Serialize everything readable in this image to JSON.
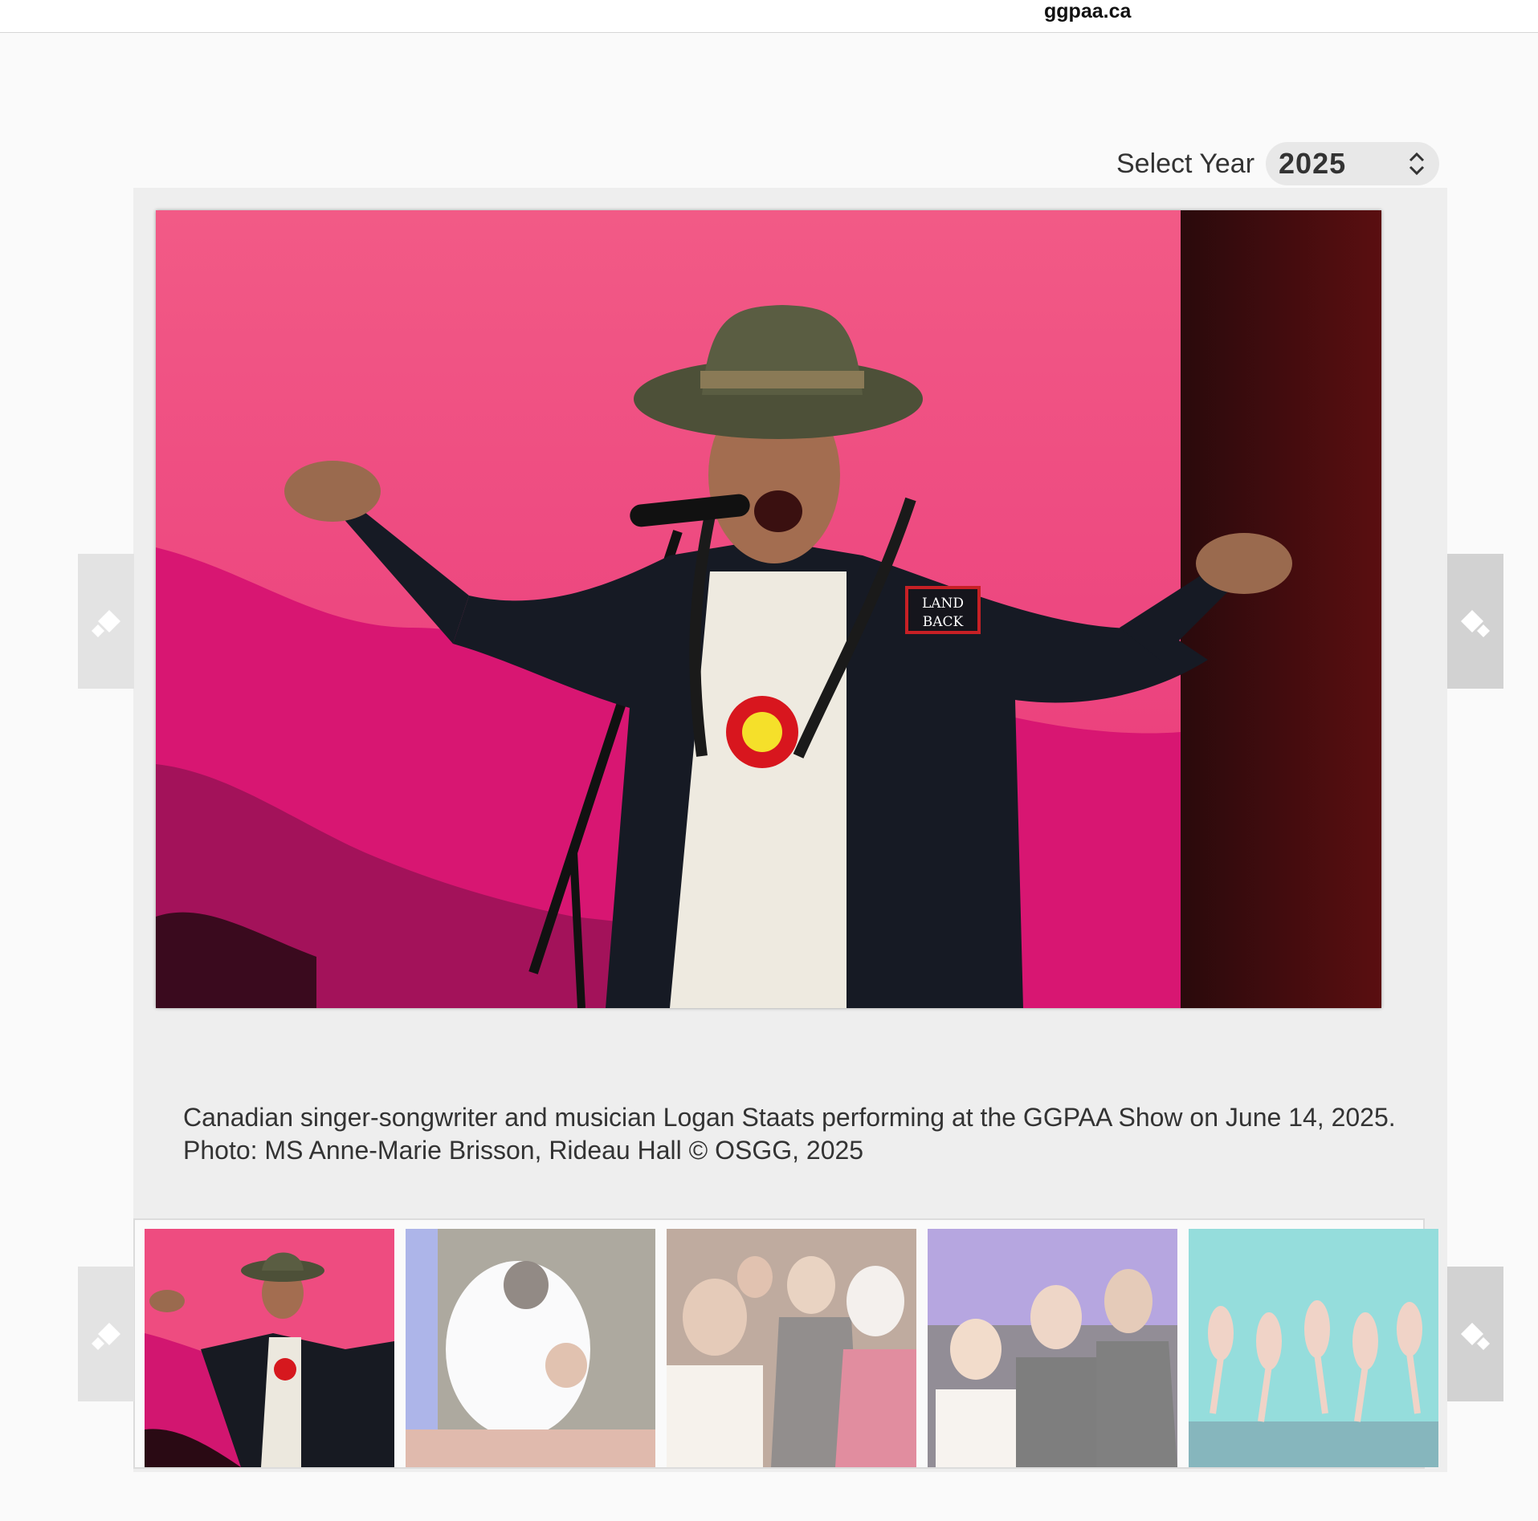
{
  "browser": {
    "url": "ggpaa.ca"
  },
  "year_selector": {
    "label": "Select Year",
    "value": "2025"
  },
  "gallery": {
    "caption": "Canadian singer-songwriter and musician Logan Staats performing at the GGPAA Show on June 14, 2025. Photo: MS Anne-Marie Brisson, Rideau Hall © OSGG, 2025",
    "main_image": {
      "patch_text_1": "LAND",
      "patch_text_2": "BACK"
    },
    "thumbnails": [
      {
        "id": "performer-singing",
        "active": true
      },
      {
        "id": "white-feathers-embrace",
        "active": false
      },
      {
        "id": "reception-group",
        "active": false
      },
      {
        "id": "three-guests-portrait",
        "active": false
      },
      {
        "id": "dance-troupe",
        "active": false
      }
    ]
  },
  "colors": {
    "accent_pink": "#ea2f72",
    "panel_bg": "#eeeeee",
    "nav_bg": "#d2d2d2"
  }
}
